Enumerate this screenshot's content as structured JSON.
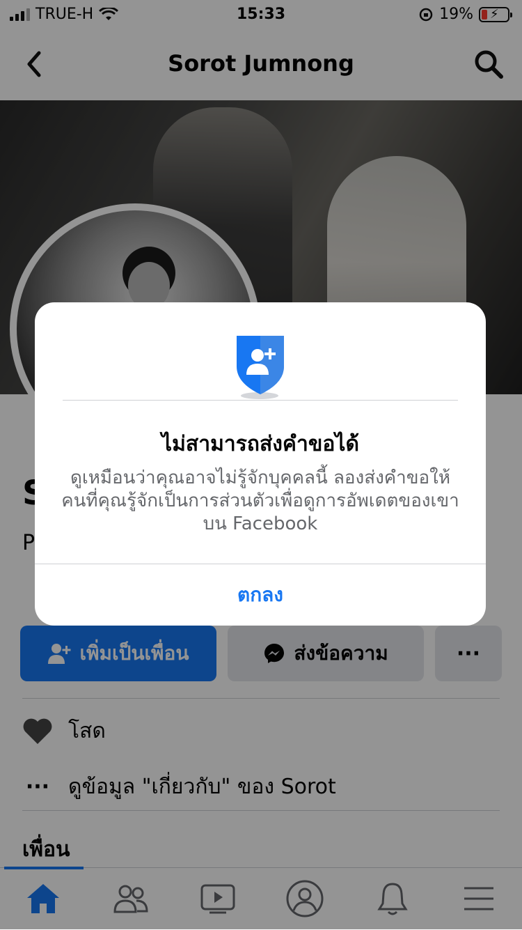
{
  "status_bar": {
    "carrier": "TRUE-H",
    "time": "15:33",
    "battery_percent": "19%",
    "battery_color": "#ff3b30"
  },
  "nav": {
    "title": "Sorot Jumnong",
    "back_icon": "chevron-left-icon",
    "search_icon": "search-icon"
  },
  "profile": {
    "name": "S",
    "subtitle": "P"
  },
  "actions": {
    "add_friend_label": "เพิ่มเป็นเพื่อน",
    "message_label": "ส่งข้อความ",
    "more_label": "···"
  },
  "info": {
    "relationship": "โสด",
    "about": "ดูข้อมูล \"เกี่ยวกับ\" ของ Sorot"
  },
  "friends": {
    "heading": "เพื่อน"
  },
  "dialog": {
    "icon": "add-friend-shield-icon",
    "title": "ไม่สามารถส่งคำขอได้",
    "body": "ดูเหมือนว่าคุณอาจไม่รู้จักบุคคลนี้ ลองส่งคำขอให้คนที่คุณรู้จักเป็นการส่วนตัวเพื่อดูการอัพเดตของเขาบน Facebook",
    "ok_label": "ตกลง"
  },
  "tabbar": {
    "tabs": [
      "home-icon",
      "friends-icon",
      "watch-icon",
      "profile-icon",
      "notifications-icon",
      "menu-icon"
    ],
    "active_index": 0
  },
  "colors": {
    "accent": "#1877f2",
    "secondary_button": "#e4e6eb"
  }
}
